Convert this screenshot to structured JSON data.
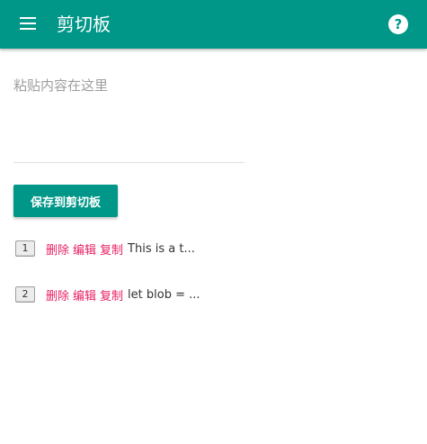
{
  "appbar": {
    "title": "剪切板",
    "help_symbol": "?",
    "color": "#009688"
  },
  "editor": {
    "placeholder": "粘贴内容在这里",
    "value": ""
  },
  "save_button": {
    "label": "保存到剪切板"
  },
  "clips": [
    {
      "index": "1",
      "delete": "删除",
      "edit": "编辑",
      "copy": "复制",
      "preview": "This is a t..."
    },
    {
      "index": "2",
      "delete": "删除",
      "edit": "编辑",
      "copy": "复制",
      "preview": "let blob = ..."
    }
  ],
  "icons": {
    "menu": "menu-icon",
    "help": "help-icon"
  },
  "colors": {
    "primary": "#009688",
    "action": "#e91e63"
  }
}
